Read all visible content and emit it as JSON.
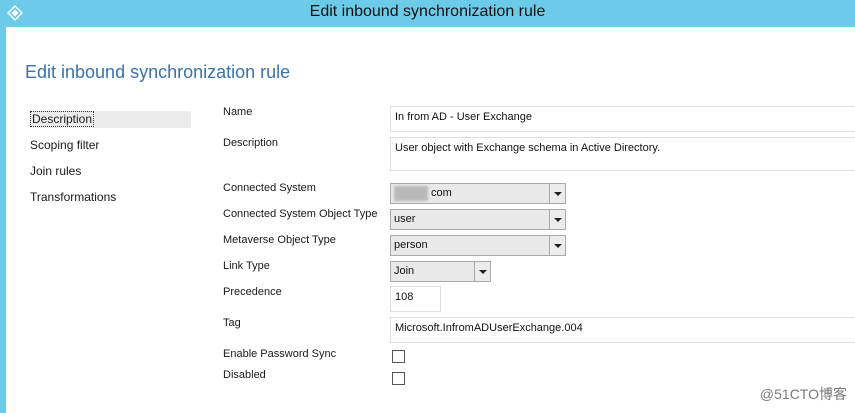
{
  "window": {
    "title": "Edit inbound synchronization rule",
    "icon": "app-diamond-icon"
  },
  "page": {
    "heading": "Edit inbound synchronization rule"
  },
  "nav": {
    "items": [
      {
        "label": "Description"
      },
      {
        "label": "Scoping filter"
      },
      {
        "label": "Join rules"
      },
      {
        "label": "Transformations"
      }
    ]
  },
  "form": {
    "name": {
      "label": "Name",
      "value": "In from AD - User Exchange"
    },
    "description": {
      "label": "Description",
      "value": "User object with Exchange schema in Active Directory."
    },
    "connected_system": {
      "label": "Connected System",
      "value": "com"
    },
    "connected_system_object_type": {
      "label": "Connected System Object Type",
      "value": "user"
    },
    "metaverse_object_type": {
      "label": "Metaverse Object Type",
      "value": "person"
    },
    "link_type": {
      "label": "Link Type",
      "value": "Join"
    },
    "precedence": {
      "label": "Precedence",
      "value": "108"
    },
    "tag": {
      "label": "Tag",
      "value": "Microsoft.InfromADUserExchange.004"
    },
    "enable_password_sync": {
      "label": "Enable Password Sync",
      "checked": false
    },
    "disabled": {
      "label": "Disabled",
      "checked": false
    }
  },
  "watermark": "@51CTO博客",
  "colors": {
    "titlebar": "#6ccbe9",
    "heading": "#3b72a8"
  }
}
